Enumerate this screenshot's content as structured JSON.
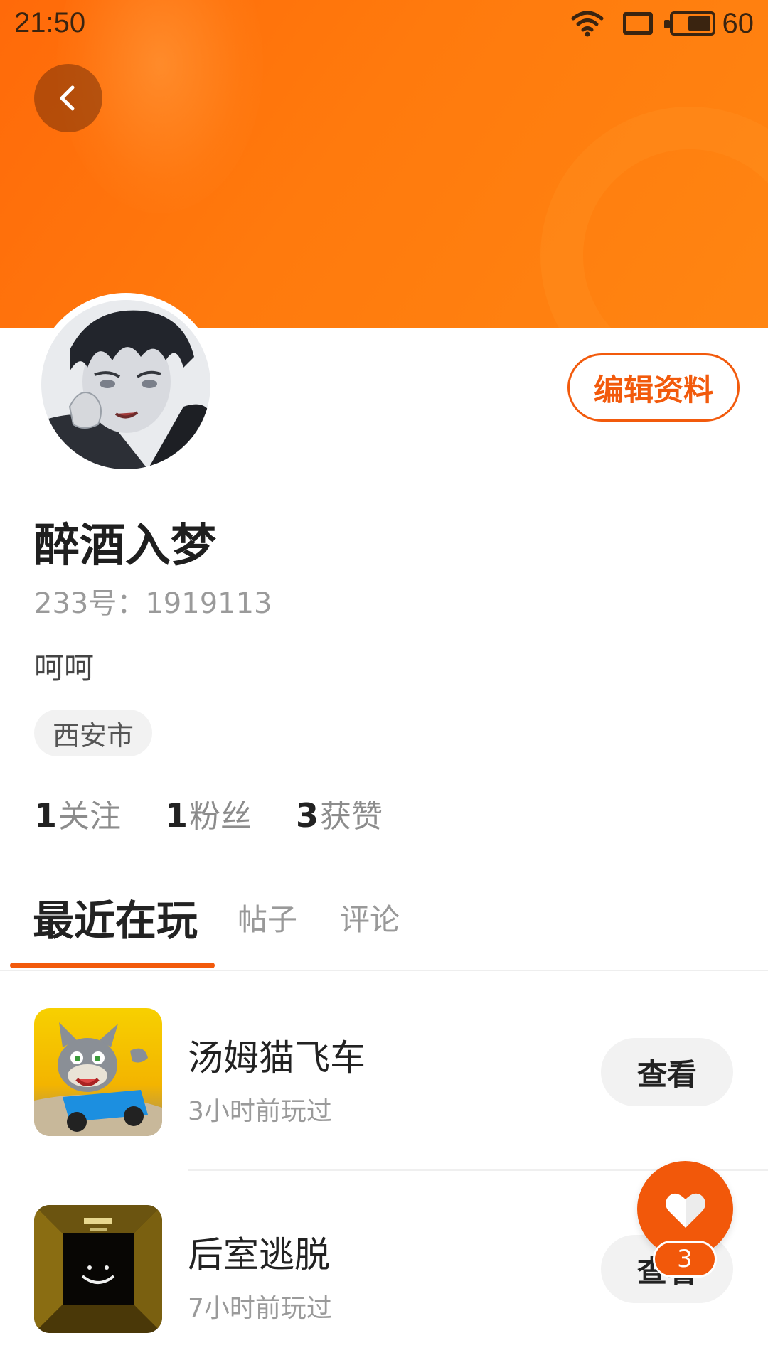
{
  "status_bar": {
    "time": "21:50",
    "battery_text": "60",
    "battery_percent": 60
  },
  "profile": {
    "username": "醉酒入梦",
    "id_text": "233号：1919113",
    "bio": "呵呵",
    "location": "西安市",
    "edit_label": "编辑资料",
    "stats": [
      {
        "count": "1",
        "label": "关注"
      },
      {
        "count": "1",
        "label": "粉丝"
      },
      {
        "count": "3",
        "label": "获赞"
      }
    ]
  },
  "tabs": [
    {
      "label": "最近在玩",
      "active": true
    },
    {
      "label": "帖子",
      "active": false
    },
    {
      "label": "评论",
      "active": false
    }
  ],
  "games": [
    {
      "name": "汤姆猫飞车",
      "time": "3小时前玩过",
      "button": "查看",
      "icon": "tom-cat-kart-icon"
    },
    {
      "name": "后室逃脱",
      "time": "7小时前玩过",
      "button": "查看",
      "icon": "backrooms-escape-icon"
    }
  ],
  "fab": {
    "icon": "heart-icon",
    "badge": "3"
  },
  "colors": {
    "accent": "#f25a0c",
    "banner": "#ff7a0d"
  }
}
